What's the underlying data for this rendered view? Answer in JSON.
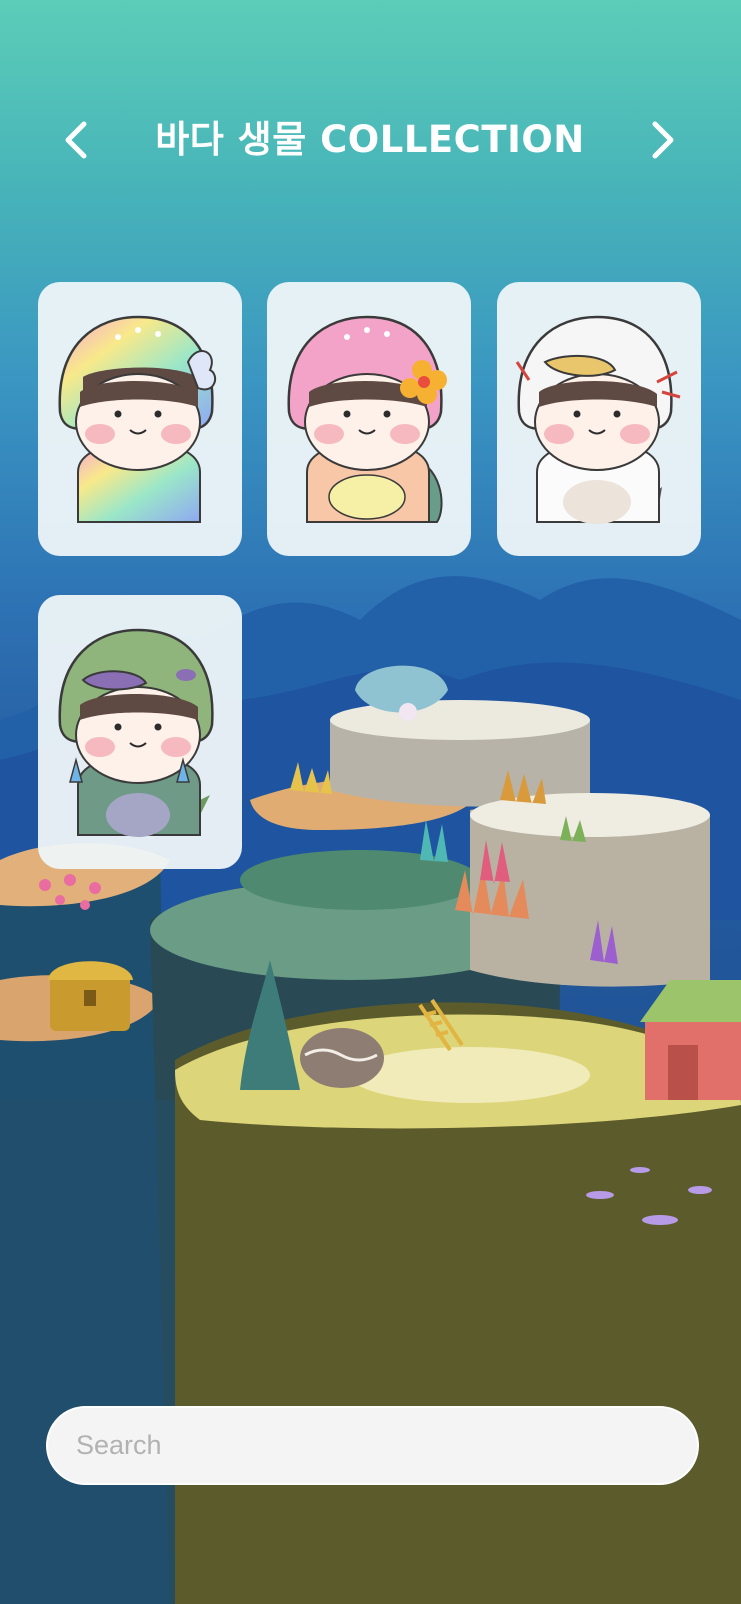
{
  "header": {
    "title": "바다 생물 COLLECTION",
    "prev_icon": "chevron-left-icon",
    "next_icon": "chevron-right-icon"
  },
  "collection": {
    "items": [
      {
        "name": "rainbow-whale-hoodie-character",
        "hood_color": "#c6b3f2",
        "accent": "butterfly"
      },
      {
        "name": "pink-turtle-hoodie-character",
        "hood_color": "#f29cc6",
        "accent": "flower"
      },
      {
        "name": "white-duck-hoodie-character",
        "hood_color": "#f7f7f7",
        "accent": "coral"
      },
      {
        "name": "green-platypus-hoodie-character",
        "hood_color": "#8fb57c",
        "accent": "earrings"
      }
    ]
  },
  "search": {
    "placeholder": "Search",
    "value": ""
  },
  "colors": {
    "sky_top": "#5ccdb8",
    "sea_deep": "#1d4a86",
    "title_text": "#ffffff",
    "card_bg": "#eef6f8"
  }
}
